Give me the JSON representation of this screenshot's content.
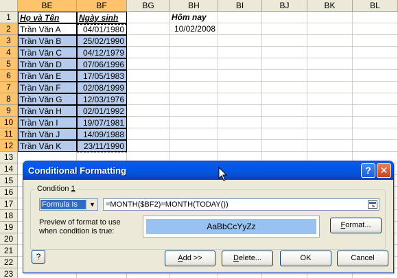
{
  "sheet": {
    "columns": [
      "BE",
      "BF",
      "BG",
      "BH",
      "BI",
      "BJ",
      "BK",
      "BL"
    ],
    "row_numbers": [
      "1",
      "2",
      "3",
      "4",
      "5",
      "6",
      "7",
      "8",
      "9",
      "10",
      "11",
      "12",
      "13",
      "14",
      "15",
      "16",
      "17",
      "18",
      "19",
      "20",
      "21",
      "22",
      "23"
    ],
    "header_name": "Họ và Tên",
    "header_date": "Ngày sinh",
    "header_today": "Hôm nay",
    "today_value": "10/02/2008",
    "rows": [
      {
        "name": "Trần Văn A",
        "date": "04/01/1980"
      },
      {
        "name": "Trần Văn B",
        "date": "25/02/1990"
      },
      {
        "name": "Trần Văn C",
        "date": "04/12/1979"
      },
      {
        "name": "Trần Văn D",
        "date": "07/06/1996"
      },
      {
        "name": "Trần Văn E",
        "date": "17/05/1983"
      },
      {
        "name": "Trần Văn F",
        "date": "02/08/1999"
      },
      {
        "name": "Trần Văn G",
        "date": "12/03/1976"
      },
      {
        "name": "Trần Văn H",
        "date": "02/01/1992"
      },
      {
        "name": "Trần Văn I",
        "date": "19/07/1981"
      },
      {
        "name": "Trần Văn J",
        "date": "14/09/1988"
      },
      {
        "name": "Trần Văn K",
        "date": "23/11/1990"
      }
    ]
  },
  "dialog": {
    "title": "Conditional Formatting",
    "help_icon": "question-mark-icon",
    "close_icon": "close-x-icon",
    "condition_label_prefix": "Condition ",
    "condition_number": "1",
    "operator_value": "Formula Is",
    "formula_value": "=MONTH($BF2)=MONTH(TODAY())",
    "preview_label_line1": "Preview of format to use",
    "preview_label_line2": "when condition is true:",
    "preview_text": "AaBbCcYyZz",
    "preview_color": "#99c2f0",
    "format_button": {
      "accel": "F",
      "rest": "ormat..."
    },
    "add_button": {
      "accel": "A",
      "rest": "dd >>"
    },
    "delete_button": {
      "accel": "D",
      "rest": "elete..."
    },
    "ok_button": "OK",
    "cancel_button": "Cancel"
  },
  "colors": {
    "selection": "#b6cbeb",
    "selected_header": "#ffc36b",
    "title_bar": "#0453d5"
  }
}
